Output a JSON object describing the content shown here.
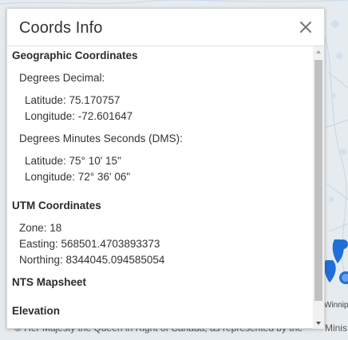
{
  "dialog": {
    "title": "Coords Info",
    "close_icon": "close-icon"
  },
  "geographic": {
    "title": "Geographic Coordinates",
    "decimal_label": "Degrees Decimal:",
    "decimal_latitude": "Latitude: 75.170757",
    "decimal_longitude": "Longitude: -72.601647",
    "dms_label": "Degrees Minutes Seconds (DMS):",
    "dms_latitude": "Latitude: 75° 10' 15\"",
    "dms_longitude": "Longitude: 72° 36' 06\""
  },
  "utm": {
    "title": "UTM Coordinates",
    "zone": "Zone: 18",
    "easting": "Easting: 568501.4703893373",
    "northing": "Northing: 8344045.094585054"
  },
  "nts": {
    "title": "NTS Mapsheet"
  },
  "elevation": {
    "title": "Elevation"
  },
  "map": {
    "label_winnipeg": "Winnip",
    "label_minis": "Minis",
    "attribution": "© Her Majesty the Queen in Right of Canada, as represented by the"
  },
  "colors": {
    "marker": "#1f6fd6",
    "scrollbar_thumb": "#c1c1c1"
  }
}
